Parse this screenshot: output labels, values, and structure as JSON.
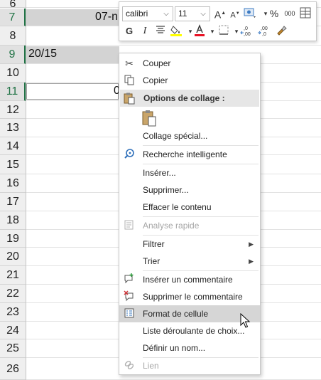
{
  "sheet": {
    "row_headers": [
      "6",
      "7",
      "8",
      "9",
      "10",
      "11",
      "12",
      "13",
      "14",
      "15",
      "16",
      "17",
      "18",
      "19",
      "20",
      "21",
      "22",
      "23",
      "24",
      "25",
      "26"
    ],
    "cell_b7": "07-n",
    "cell_a9": "20/15",
    "cell_b11": "0"
  },
  "mini_toolbar": {
    "font_name": "calibri",
    "font_size": "11",
    "icons": [
      "increase-font-size",
      "decrease-font-size",
      "accounting-format",
      "percent-style",
      "comma-style",
      "format-painter-table",
      "bold",
      "italic",
      "align-center",
      "fill-color",
      "font-color",
      "borders",
      "increase-decimal",
      "decrease-decimal",
      "format-painter"
    ],
    "bold_label": "G",
    "italic_label": "I",
    "grow_label": "A",
    "percent_label": "%",
    "thousands_label": "000",
    "fill_color": "#ffff00",
    "font_color": "#ff0000"
  },
  "menu": {
    "cut": "Couper",
    "copy": "Copier",
    "paste_options": "Options de collage :",
    "paste_special": "Collage spécial...",
    "smart_lookup": "Recherche intelligente",
    "insert": "Insérer...",
    "delete": "Supprimer...",
    "clear_contents": "Effacer le contenu",
    "quick_analysis": "Analyse rapide",
    "filter": "Filtrer",
    "sort": "Trier",
    "insert_comment": "Insérer un commentaire",
    "delete_comment": "Supprimer le commentaire",
    "format_cells": "Format de cellule",
    "pick_list": "Liste déroulante de choix...",
    "define_name": "Définir un nom...",
    "link": "Lien"
  }
}
